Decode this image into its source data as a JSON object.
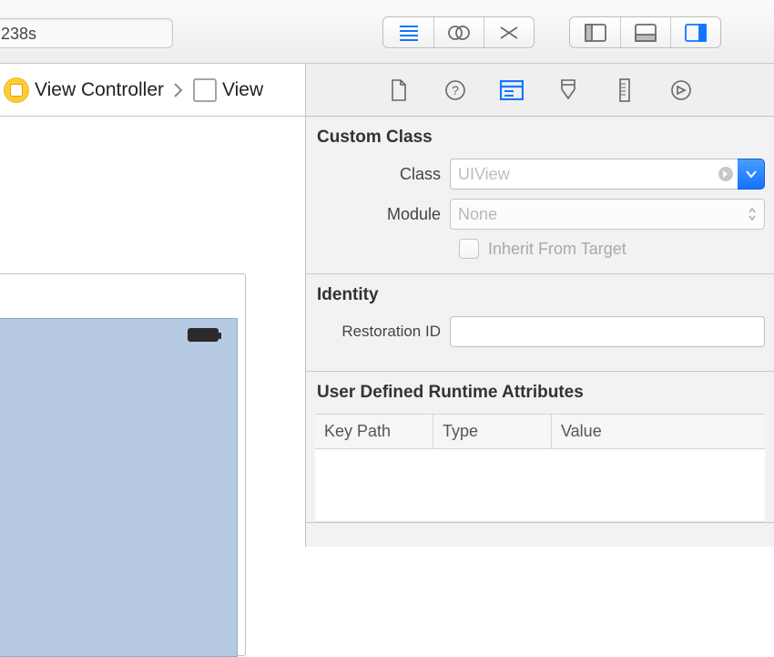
{
  "toolbar": {
    "search_value": "238s"
  },
  "breadcrumb": {
    "item1": "View Controller",
    "item2": "View"
  },
  "inspector": {
    "custom_class": {
      "title": "Custom Class",
      "class_label": "Class",
      "class_placeholder": "UIView",
      "module_label": "Module",
      "module_value": "None",
      "inherit_label": "Inherit From Target"
    },
    "identity": {
      "title": "Identity",
      "restoration_label": "Restoration ID",
      "restoration_value": ""
    },
    "runtime": {
      "title": "User Defined Runtime Attributes",
      "columns": [
        "Key Path",
        "Type",
        "Value"
      ]
    }
  }
}
